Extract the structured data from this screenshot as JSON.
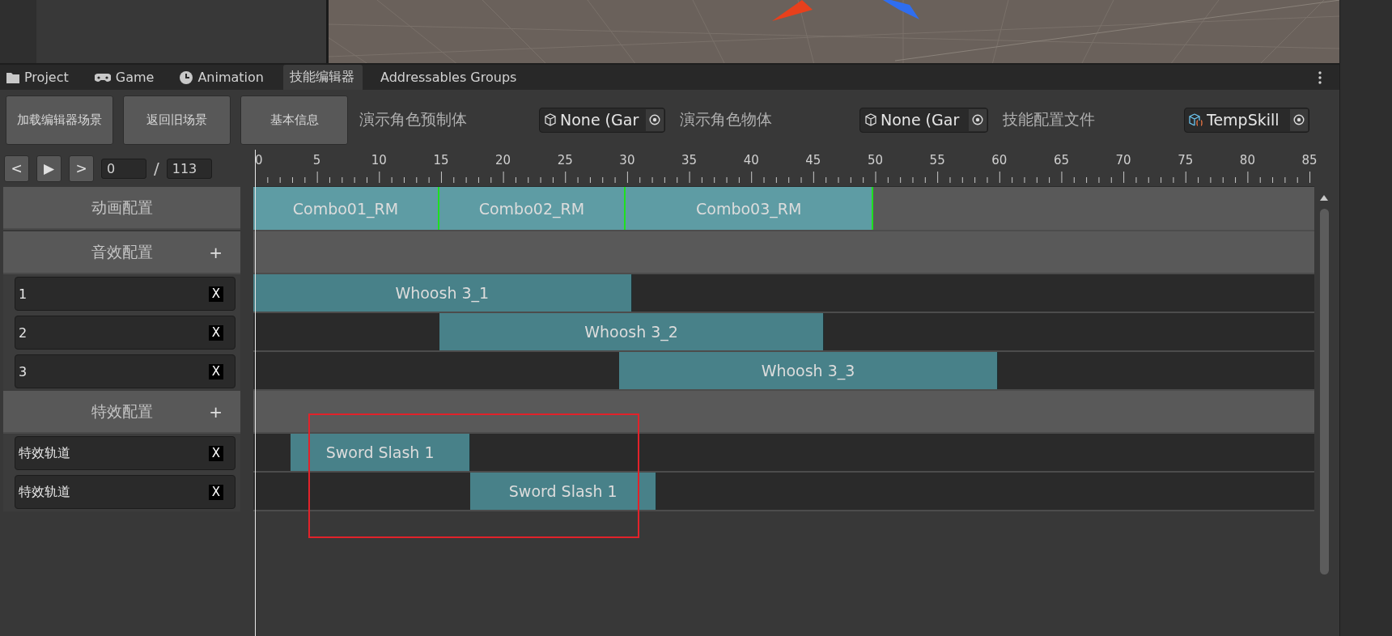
{
  "tabs": [
    {
      "label": "Project",
      "selected": false
    },
    {
      "label": "Game",
      "selected": false
    },
    {
      "label": "Animation",
      "selected": false
    },
    {
      "label": "技能编辑器",
      "selected": true
    },
    {
      "label": "Addressables Groups",
      "selected": false
    }
  ],
  "toolbar": {
    "buttons": [
      "加载编辑器场景",
      "返回旧场景",
      "基本信息"
    ],
    "fields": [
      {
        "label": "演示角色预制体",
        "value": "None (Gar",
        "kind": "gameobject"
      },
      {
        "label": "演示角色物体",
        "value": "None (Gar",
        "kind": "gameobject"
      },
      {
        "label": "技能配置文件",
        "value": "TempSkill",
        "kind": "script"
      }
    ]
  },
  "playback": {
    "buttons": [
      "<",
      "▶",
      ">"
    ],
    "current_frame": "0",
    "separator": "/",
    "total_frames": "113"
  },
  "ruler": {
    "labels": [
      "0",
      "5",
      "10",
      "15",
      "20",
      "25",
      "30",
      "35",
      "40",
      "45",
      "50",
      "55",
      "60",
      "65",
      "70",
      "75",
      "80",
      "85"
    ]
  },
  "sections": [
    {
      "kind": "animation",
      "title": "动画配置",
      "clips": [
        {
          "name": "Combo01_RM"
        },
        {
          "name": "Combo02_RM"
        },
        {
          "name": "Combo03_RM"
        }
      ]
    },
    {
      "kind": "audio",
      "title": "音效配置",
      "add_button": "+",
      "tracks": [
        {
          "name": "1",
          "remove_button": "X",
          "clips": [
            {
              "name": "Whoosh 3_1"
            }
          ]
        },
        {
          "name": "2",
          "remove_button": "X",
          "clips": [
            {
              "name": "Whoosh 3_2"
            }
          ]
        },
        {
          "name": "3",
          "remove_button": "X",
          "clips": [
            {
              "name": "Whoosh 3_3"
            }
          ]
        }
      ]
    },
    {
      "kind": "effect",
      "title": "特效配置",
      "add_button": "+",
      "tracks": [
        {
          "name": "特效轨道",
          "remove_button": "X",
          "clips": [
            {
              "name": "Sword Slash 1"
            }
          ]
        },
        {
          "name": "特效轨道",
          "remove_button": "X",
          "clips": [
            {
              "name": "Sword Slash 1"
            }
          ]
        }
      ]
    }
  ]
}
